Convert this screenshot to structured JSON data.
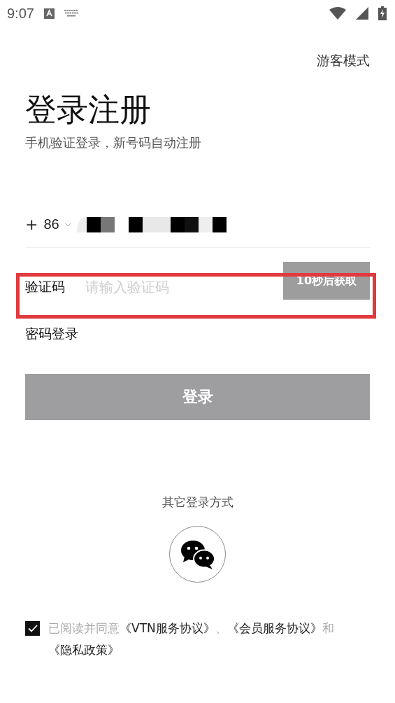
{
  "status_bar": {
    "time": "9:07"
  },
  "guest_mode": "游客模式",
  "title": "登录注册",
  "subtitle": "手机验证登录，新号码自动注册",
  "phone": {
    "plus": "+",
    "country_code": "86"
  },
  "code_field": {
    "label": "验证码",
    "placeholder": "请输入验证码",
    "send_button": {
      "label": "10秒后获取",
      "disabled": true
    },
    "highlighted": true
  },
  "password_login": "密码登录",
  "login_button": {
    "label": "登录",
    "disabled": true
  },
  "other_login": {
    "title": "其它登录方式"
  },
  "agreement": {
    "checked": true,
    "parts": [
      {
        "kind": "text",
        "text": "已阅读并同意"
      },
      {
        "kind": "link",
        "text": "《VTN服务协议》"
      },
      {
        "kind": "text",
        "text": "、"
      },
      {
        "kind": "link",
        "text": "《会员服务协议》"
      },
      {
        "kind": "text",
        "text": "和"
      },
      {
        "kind": "link",
        "text": "《隐私政策》"
      }
    ]
  }
}
